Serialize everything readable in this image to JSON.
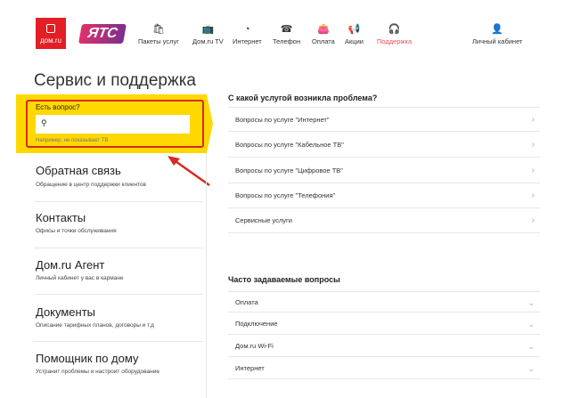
{
  "header": {
    "logo1": "дом.ru",
    "logo2": "ЯТС",
    "nav": [
      {
        "label": "Пакеты услуг",
        "icon": "🛍"
      },
      {
        "label": "Дом.ru TV",
        "icon": "📺"
      },
      {
        "label": "Интернет",
        "icon": "◔"
      },
      {
        "label": "Телефон",
        "icon": "☎"
      },
      {
        "label": "Оплата",
        "icon": "👛"
      },
      {
        "label": "Акции",
        "icon": "📢"
      },
      {
        "label": "Поддержка",
        "icon": "🎧"
      }
    ],
    "account": "Личный кабинет",
    "account_icon": "👤"
  },
  "title": "Сервис и поддержка",
  "question": {
    "label": "Есть вопрос?",
    "placeholder": "",
    "hint": "Например, не показывает ТВ"
  },
  "left": [
    {
      "title": "Обратная связь",
      "sub": "Обращение в центр поддержки клиентов"
    },
    {
      "title": "Контакты",
      "sub": "Офисы и точки обслуживания"
    },
    {
      "title": "Дом.ru Агент",
      "sub": "Личный кабинет у вас в кармане"
    },
    {
      "title": "Документы",
      "sub": "Описание тарифных планов, договоры и т.д"
    },
    {
      "title": "Помощник по дому",
      "sub": "Устранит проблемы и настроит оборудование"
    }
  ],
  "services": {
    "heading": "С какой услугой возникла проблема?",
    "items": [
      "Вопросы по услуге \"Интернет\"",
      "Вопросы по услуге \"Кабельное ТВ\"",
      "Вопросы по услуге \"Цифровое ТВ\"",
      "Вопросы по услуге \"Телефония\"",
      "Сервисные услуги"
    ]
  },
  "faq": {
    "heading": "Часто задаваемые вопросы",
    "items": [
      "Оплата",
      "Подключение",
      "Дом.ru Wi-Fi",
      "Интернет"
    ]
  },
  "colors": {
    "brand": "#e31e24",
    "highlight": "#ffd800",
    "annotation": "#d8291f"
  }
}
